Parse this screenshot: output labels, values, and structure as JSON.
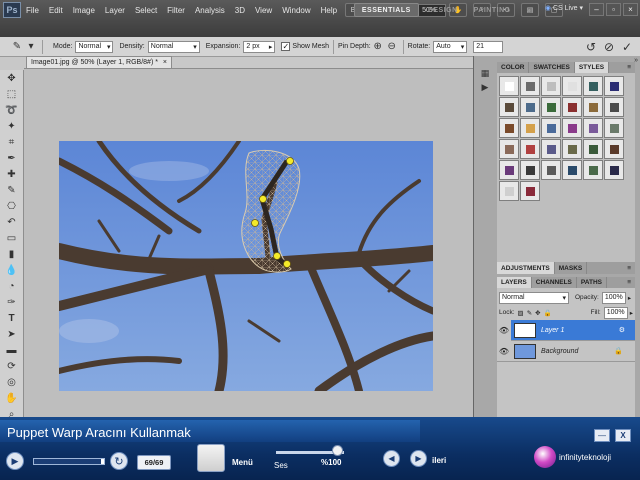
{
  "app": {
    "logo_text": "Ps",
    "menus": [
      "File",
      "Edit",
      "Image",
      "Layer",
      "Select",
      "Filter",
      "Analysis",
      "3D",
      "View",
      "Window",
      "Help"
    ],
    "zoom": "50%",
    "workspaces": [
      "ESSENTIALS",
      "DESIGN",
      "PAINTING"
    ],
    "active_workspace": "ESSENTIALS",
    "cslive": "CS Live"
  },
  "options": {
    "mode_label": "Mode:",
    "mode_value": "Normal",
    "density_label": "Density:",
    "density_value": "Normal",
    "expansion_label": "Expansion:",
    "expansion_value": "2 px",
    "show_mesh_label": "Show Mesh",
    "show_mesh_checked": true,
    "pin_depth_label": "Pin Depth:",
    "rotate_label": "Rotate:",
    "rotate_mode": "Auto",
    "rotate_value": "21"
  },
  "document": {
    "tab_title": "Image01.jpg @ 50% (Layer 1, RGB/8#) *",
    "tab_close": "×"
  },
  "swatches_panel": {
    "tabs": [
      "COLOR",
      "SWATCHES",
      "STYLES"
    ],
    "active_tab": "STYLES",
    "style_colors": [
      "#ffffff",
      "#6b6b6b",
      "#bdbdbd",
      "#e0e0e0",
      "#356060",
      "#2b2d73",
      "#5a4a3a",
      "#4d6b8b",
      "#3b6b3b",
      "#8a2f2f",
      "#8b6a3a",
      "#4a4a4a",
      "#7a4a2a",
      "#d4a04a",
      "#4a6a9a",
      "#8a3a8a",
      "#7a5a9a",
      "#6a7a6a",
      "#8a6a5a",
      "#b04040",
      "#5a5a8a",
      "#6a6a4a",
      "#3a5a3a",
      "#5a3a2a",
      "#6a3a7a",
      "#3a3a3a",
      "#5a5a5a",
      "#2a4a6a",
      "#4a6a4a",
      "#2a2a4a",
      "#cfcfcf",
      "#8a2a3a"
    ]
  },
  "adjust_panel": {
    "tabs": [
      "ADJUSTMENTS",
      "MASKS"
    ]
  },
  "layers_panel": {
    "tabs": [
      "LAYERS",
      "CHANNELS",
      "PATHS"
    ],
    "blend_mode": "Normal",
    "opacity_label": "Opacity:",
    "opacity_value": "100%",
    "lock_label": "Lock:",
    "fill_label": "Fill:",
    "fill_value": "100%",
    "layers": [
      {
        "name": "Layer 1",
        "selected": true
      },
      {
        "name": "Background",
        "selected": false
      }
    ]
  },
  "player": {
    "title": "Puppet Warp Aracını Kullanmak",
    "progress": 0.95,
    "page_count": "69/69",
    "menu_label": "Menü",
    "volume_label": "Ses",
    "volume_value": "%100",
    "volume_level": 0.9,
    "next_label": "ileri",
    "brand": "infinityteknoloji",
    "min_label": "—",
    "close_label": "X"
  }
}
